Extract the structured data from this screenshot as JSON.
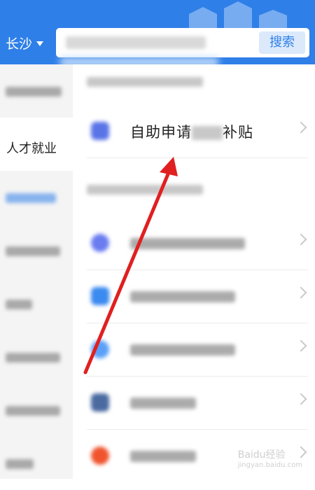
{
  "header": {
    "city": "长沙",
    "search_button": "搜索"
  },
  "sidebar": {
    "items": [
      {
        "label": ""
      },
      {
        "label": "人才就业"
      },
      {
        "label": ""
      },
      {
        "label": ""
      },
      {
        "label": ""
      },
      {
        "label": ""
      },
      {
        "label": ""
      },
      {
        "label": ""
      }
    ]
  },
  "main": {
    "rows": [
      {
        "label_start": "自助申请",
        "label_end": "补贴"
      }
    ]
  },
  "colors": {
    "brand_blue": "#2f7fe8",
    "annotation_red": "#e02020"
  },
  "watermark": {
    "line1": "Baidu经验",
    "line2": "jingyan.baidu.com"
  }
}
